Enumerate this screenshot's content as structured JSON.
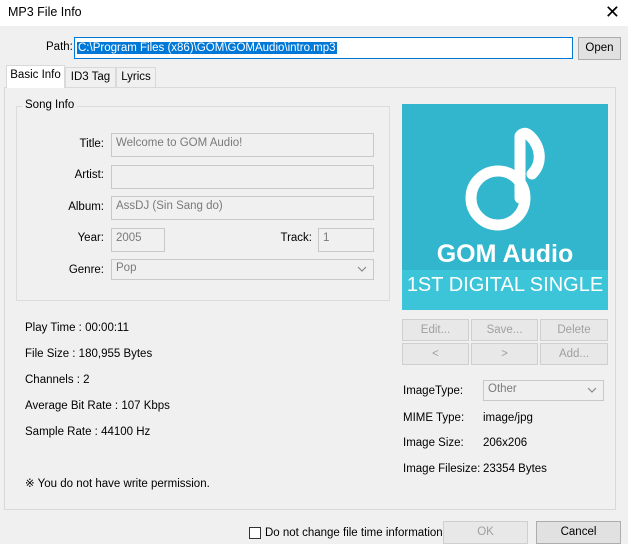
{
  "window": {
    "title": "MP3 File Info",
    "close_glyph": "✕"
  },
  "path": {
    "label": "Path:",
    "value": "C:\\Program Files (x86)\\GOM\\GOMAudio\\intro.mp3",
    "open_label": "Open"
  },
  "tabs": [
    {
      "label": "Basic Info"
    },
    {
      "label": "ID3 Tag"
    },
    {
      "label": "Lyrics"
    }
  ],
  "song_info": {
    "group_label": "Song Info",
    "title_label": "Title:",
    "title_value": "Welcome to GOM Audio!",
    "artist_label": "Artist:",
    "artist_value": "",
    "album_label": "Album:",
    "album_value": "AssDJ (Sin Sang do)",
    "year_label": "Year:",
    "year_value": "2005",
    "track_label": "Track:",
    "track_value": "1",
    "genre_label": "Genre:",
    "genre_value": "Pop"
  },
  "album_art": {
    "brand": "GOM Audio",
    "subtitle": "1ST DIGITAL SINGLE",
    "bg_color": "#31b6cd"
  },
  "image_buttons": {
    "edit": "Edit...",
    "save": "Save...",
    "delete": "Delete",
    "prev": "<",
    "next": ">",
    "add": "Add..."
  },
  "stats": {
    "play_time": "Play Time : 00:00:11",
    "file_size": "File Size : 180,955 Bytes",
    "channels": "Channels : 2",
    "bit_rate": "Average Bit Rate : 107 Kbps",
    "sample_rate": "Sample Rate : 44100 Hz",
    "permission": "※ You do not have write permission."
  },
  "image_info": {
    "type_label": "ImageType:",
    "type_value": "Other",
    "mime_label": "MIME Type:",
    "mime_value": "image/jpg",
    "size_label": "Image Size:",
    "size_value": "206x206",
    "filesize_label": "Image Filesize:",
    "filesize_value": "23354 Bytes"
  },
  "footer": {
    "checkbox_label": "Do not change file time information",
    "ok_label": "OK",
    "cancel_label": "Cancel"
  }
}
